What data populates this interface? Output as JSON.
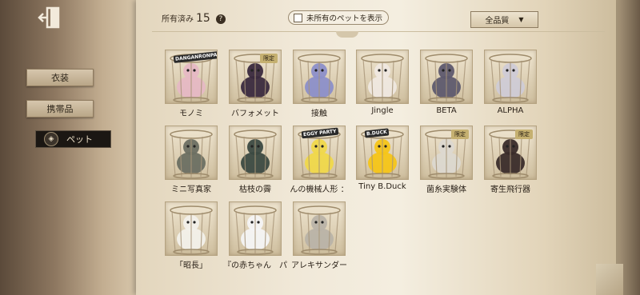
{
  "sidebar": {
    "exit_icon": "exit-door-icon",
    "items": [
      {
        "label": "衣装"
      },
      {
        "label": "携帯品"
      },
      {
        "label": "ペット",
        "icon": "shield-emblem-icon",
        "active": true
      }
    ]
  },
  "header": {
    "owned_label": "所有済み",
    "owned_count": "15",
    "help_glyph": "?",
    "show_unowned_label": "未所有のペットを表示",
    "show_unowned_checked": false,
    "quality_filter": "全品質"
  },
  "pets": [
    {
      "name": "モノミ",
      "color": "#e6b8c4",
      "badge": "DANGANRONPA"
    },
    {
      "name": "バフォメット",
      "color": "#3a2a3e",
      "limited": "限定"
    },
    {
      "name": "接触",
      "color": "#8c8fc9"
    },
    {
      "name": "Jingle",
      "color": "#efe8e0"
    },
    {
      "name": "BETA",
      "color": "#5e5a6e"
    },
    {
      "name": "ALPHA",
      "color": "#cfcbd6"
    },
    {
      "name": "ミニ写真家",
      "color": "#6b6f62"
    },
    {
      "name": "枯枝の霽",
      "color": "#3c4a42"
    },
    {
      "name": "んの機械人形 ：",
      "color": "#f0d84a",
      "badge": "EGGY PARTY"
    },
    {
      "name": "Tiny B.Duck",
      "color": "#f5c518",
      "badge": "B.DUCK"
    },
    {
      "name": "菌糸実験体",
      "color": "#dcd8d0",
      "limited": "限定"
    },
    {
      "name": "寄生飛行器",
      "color": "#3a2c2a",
      "limited": "限定"
    },
    {
      "name": "「昭長」",
      "color": "#f2f0ea"
    },
    {
      "name": "『の赤ちゃん　パ",
      "color": "#f4f4f4"
    },
    {
      "name": "アレキサンダー",
      "color": "#b9b3a8"
    }
  ]
}
